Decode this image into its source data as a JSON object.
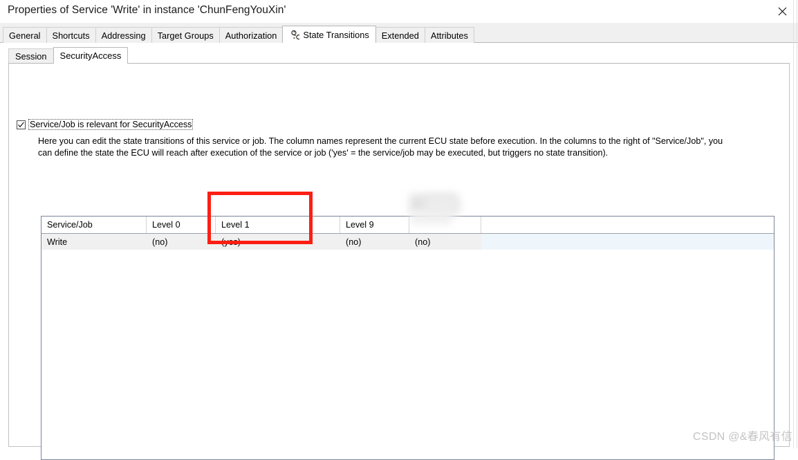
{
  "window": {
    "title": "Properties of Service 'Write' in instance 'ChunFengYouXin'",
    "close_icon": "close-icon"
  },
  "tabs": [
    {
      "label": "General",
      "active": false
    },
    {
      "label": "Shortcuts",
      "active": false
    },
    {
      "label": "Addressing",
      "active": false
    },
    {
      "label": "Target Groups",
      "active": false
    },
    {
      "label": "Authorization",
      "active": false
    },
    {
      "label": "State Transitions",
      "active": true,
      "icon": "state-transitions-icon"
    },
    {
      "label": "Extended",
      "active": false
    },
    {
      "label": "Attributes",
      "active": false
    }
  ],
  "subtabs": [
    {
      "label": "Session",
      "active": false
    },
    {
      "label": "SecurityAccess",
      "active": true
    }
  ],
  "checkbox": {
    "label": "Service/Job is relevant for SecurityAccess",
    "checked": true
  },
  "description": "Here you can edit the state transitions of this service or job. The column names represent the current ECU state before execution. In the columns to the right of \"Service/Job\", you can define the state the ECU will reach after execution of the service or job ('yes' = the service/job may be executed, but triggers no state transition).",
  "table": {
    "columns": [
      "Service/Job",
      "Level 0",
      "Level 1",
      "Level 9",
      ""
    ],
    "rows": [
      {
        "cells": [
          "Write",
          "(no)",
          "(yes)",
          "(no)",
          "(no)"
        ]
      }
    ]
  },
  "annotation": {
    "highlight_color": "#fd1e13",
    "target_column": "Level 1"
  },
  "watermark": "CSDN @&春风有信"
}
